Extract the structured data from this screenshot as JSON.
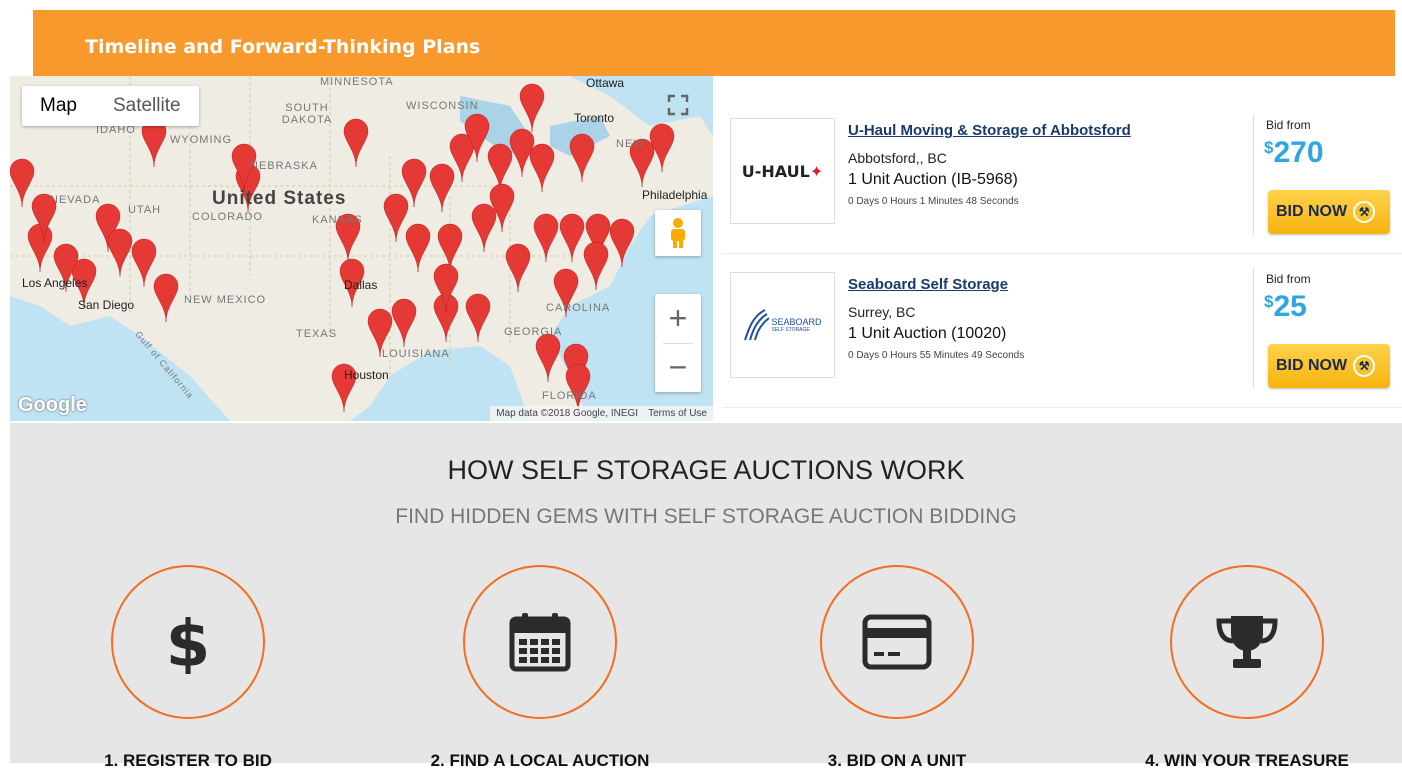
{
  "banner": {
    "title": "Timeline and Forward-Thinking Plans"
  },
  "map": {
    "map_type_map": "Map",
    "map_type_satellite": "Satellite",
    "labels": {
      "minnesota": "MINNESOTA",
      "ottawa": "Ottawa",
      "toronto": "Toronto",
      "wisconsin": "WISCONSIN",
      "south_dakota": "SOUTH DAKOTA",
      "idaho": "IDAHO",
      "wyoming": "WYOMING",
      "nebraska": "NEBRASKA",
      "nevada": "NEVADA",
      "utah": "UTAH",
      "colorado": "COLORADO",
      "united_states": "United States",
      "kansas": "KANSAS",
      "new_york": "NEW",
      "philadelphia": "Philadelphia",
      "los_angeles": "Los Angeles",
      "san_diego": "San Diego",
      "new_mexico": "NEW MEXICO",
      "texas": "TEXAS",
      "dallas": "Dallas",
      "louisiana": "LOUISIANA",
      "houston": "Houston",
      "georgia": "GEORGIA",
      "carolina": "CAROLINA",
      "florida": "FLORIDA",
      "gulf": "Gulf of California"
    },
    "google": "Google",
    "attribution": "Map data ©2018 Google, INEGI",
    "terms": "Terms of Use"
  },
  "listings": [
    {
      "logo": "U-HAUL",
      "name": "U-Haul Moving & Storage of Abbotsford",
      "location": "Abbotsford,, BC",
      "unit": "1 Unit Auction (IB-5968)",
      "timer": "0 Days 0 Hours 1 Minutes 48 Seconds",
      "bid_from": "Bid from",
      "currency": "$",
      "amount": "270",
      "button": "BID NOW"
    },
    {
      "logo": "SEABOARD",
      "logo_sub": "SELF STORAGE",
      "name": "Seaboard Self Storage",
      "location": "Surrey, BC",
      "unit": "1 Unit Auction (10020)",
      "timer": "0 Days 0 Hours 55 Minutes 49 Seconds",
      "bid_from": "Bid from",
      "currency": "$",
      "amount": "25",
      "button": "BID NOW"
    }
  ],
  "how": {
    "title": "HOW SELF STORAGE AUCTIONS WORK",
    "subtitle": "FIND HIDDEN GEMS WITH SELF STORAGE AUCTION BIDDING",
    "steps": [
      {
        "label": "1. REGISTER TO BID",
        "icon": "dollar-icon"
      },
      {
        "label": "2. FIND A LOCAL AUCTION",
        "icon": "calendar-icon"
      },
      {
        "label": "3. BID ON A UNIT",
        "icon": "credit-card-icon"
      },
      {
        "label": "4. WIN YOUR TREASURE",
        "icon": "trophy-icon"
      }
    ]
  },
  "colors": {
    "banner": "#f7992d",
    "accent": "#f56e1f",
    "bid_amount": "#2ea6e0",
    "button": "#f6b40f"
  }
}
